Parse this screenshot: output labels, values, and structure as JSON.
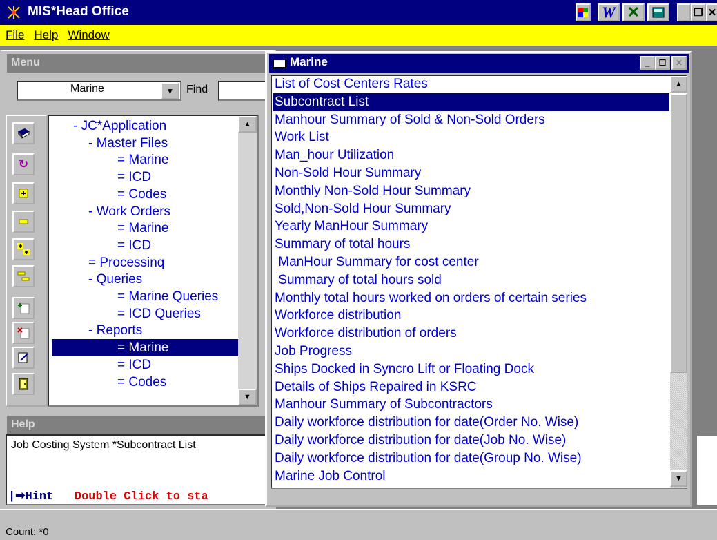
{
  "window": {
    "title": "MIS*Head Office",
    "icon": "mis-app-icon"
  },
  "menubar": {
    "items": [
      {
        "label": "File",
        "accel": "F"
      },
      {
        "label": "Help",
        "accel": "H"
      },
      {
        "label": "Window",
        "accel": "W"
      }
    ]
  },
  "menu_panel": {
    "header": "Menu",
    "combo_value": "Marine",
    "find_label": "Find",
    "find_value": "",
    "tree": [
      {
        "text": "- JC*Application",
        "level": 0
      },
      {
        "text": "- Master Files",
        "level": 1
      },
      {
        "text": "= Marine",
        "level": 2
      },
      {
        "text": "= ICD",
        "level": 2
      },
      {
        "text": "= Codes",
        "level": 2
      },
      {
        "text": "- Work Orders",
        "level": 1
      },
      {
        "text": "= Marine",
        "level": 2
      },
      {
        "text": "= ICD",
        "level": 2
      },
      {
        "text": "= Processinq",
        "level": 1
      },
      {
        "text": "- Queries",
        "level": 1
      },
      {
        "text": "= Marine Queries",
        "level": 2
      },
      {
        "text": "= ICD Queries",
        "level": 2
      },
      {
        "text": "- Reports",
        "level": 1
      },
      {
        "text": "= Marine",
        "level": 2,
        "selected": true
      },
      {
        "text": "= ICD",
        "level": 2
      },
      {
        "text": "= Codes",
        "level": 2
      }
    ],
    "tools": [
      "book-icon",
      "refresh-icon",
      "expand-icon",
      "collapse-icon",
      "expand-all-icon",
      "collapse-all-icon",
      "add-record-icon",
      "delete-record-icon",
      "edit-record-icon",
      "exit-door-icon"
    ]
  },
  "help_panel": {
    "header": "Help",
    "text": "Job Costing System *Subcontract List",
    "hint_label": "Hint",
    "hint_text": "Double Click to sta"
  },
  "marine_window": {
    "title": "Marine",
    "items": [
      "List of Cost Centers Rates",
      "Subcontract List",
      "Manhour Summary of Sold & Non-Sold Orders",
      "Work List",
      "Man_hour Utilization",
      "Non-Sold Hour Summary",
      "Monthly Non-Sold Hour Summary",
      "Sold,Non-Sold Hour Summary",
      "Yearly ManHour Summary",
      "Summary of total hours",
      " ManHour Summary for cost center",
      " Summary of total hours sold",
      "Monthly total hours worked on orders of certain series",
      "Workforce distribution",
      "Workforce distribution of orders",
      "Job Progress",
      "Ships Docked in Syncro Lift or Floating Dock",
      "Details of Ships Repaired in KSRC",
      "Manhour Summary of Subcontractors",
      "Daily workforce distribution for date(Order No. Wise)",
      "Daily workforce distribution for date(Job No. Wise)",
      "Daily workforce distribution for date(Group No. Wise)",
      "Marine Job Control"
    ],
    "selected_index": 1
  },
  "statusbar": {
    "text": "Count: *0"
  },
  "colors": {
    "titlebar": "#000080",
    "menubar": "#ffff00",
    "link_text": "#0000d0",
    "hint_text": "#e00000"
  }
}
